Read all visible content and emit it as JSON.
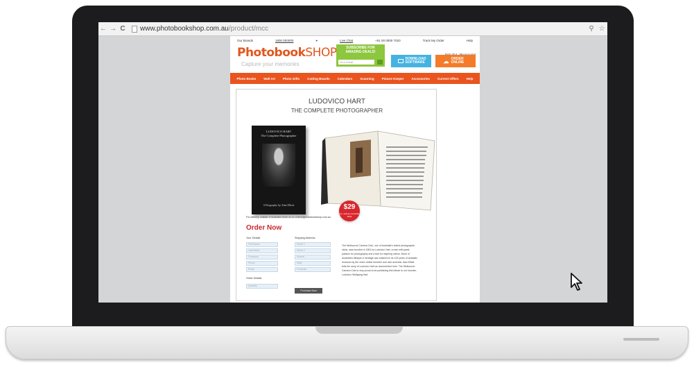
{
  "browser": {
    "back": "←",
    "forward": "→",
    "reload": "C",
    "url_host": "www.photobookshop.com.au",
    "url_path": "/product/mcc",
    "zoom_icon": "zoom-icon",
    "star_icon": "bookmark-star-icon"
  },
  "site": {
    "topbar": {
      "our_brands": "Our Brands",
      "phone": "1800 000000",
      "live_chat": "Live Chat",
      "intl_phone": "+61 00 0000 7020",
      "track_order": "Track My Order",
      "help": "Help",
      "sign_out": "Sign Out",
      "my_account": "My Account"
    },
    "logo": {
      "bold": "Photobook",
      "light": "SHOP"
    },
    "tagline": "Capture your memories",
    "subscribe": {
      "line1": "SUBSCRIBE FOR",
      "line2": "AMAZING DEALS!",
      "email_placeholder": "Your Email"
    },
    "download_button": "DOWNLOAD SOFTWARE",
    "order_button": "ORDER ONLINE",
    "menu": [
      "Photo Books",
      "Wall Art",
      "Photo Gifts",
      "Cutting Boards",
      "Calendars",
      "Scanning",
      "Picture Keeper",
      "Accessories",
      "Current Offers",
      "Help"
    ],
    "product": {
      "author": "LUDOVICO HART",
      "subtitle": "THE COMPLETE PHOTOGRAPHER",
      "cover_line1": "LUDOVICO HART",
      "cover_line2": "The Complete Photographer",
      "cover_byline": "A Biography by Alan Elliott",
      "price": "$29",
      "price_note": "inc. delivery Australia Wide",
      "fineprint": "For delivery outside of Australia email us on orders@photobookshop.com.au",
      "order_title": "Order Now",
      "your_details_label": "Your Details",
      "shipping_label": "Shipping Address",
      "order_details_label": "Order Details",
      "details_fields": [
        "First Name",
        "Last Name",
        "Company",
        "Phone",
        "Email"
      ],
      "shipping_fields": [
        "Street 1",
        "Street 2",
        "Suburb",
        "State",
        "Postcode"
      ],
      "quantity_placeholder": "Quantity",
      "purchase_button": "Purchase Now",
      "description": "The Melbourne Camera Club, one of Australia's oldest photographic clubs, was founded in 1891 by Ludovico Hart, a man with great passion for photography and a flair for inspiring others. Much of Australia's lifestyle & heritage was fostered in its 125 years of fantastic research by the club's oldest member and club archivist. Alan Elliott tells the story of Ludovico Hart as documented here. The Melbourne Camera Club is very proud to be publishing this tribute to our founder, Ludovico Wolfgang Hart."
    }
  }
}
